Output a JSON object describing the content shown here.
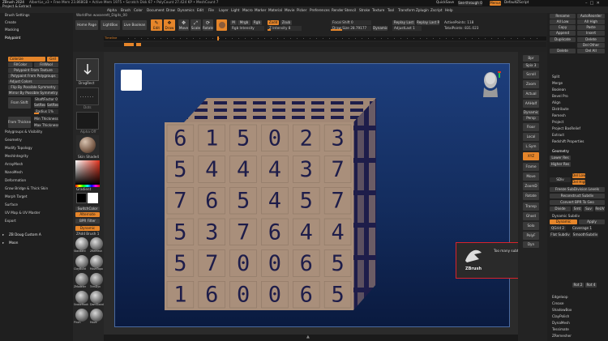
{
  "titlebar": {
    "app": "ZBrush 2024",
    "items": [
      "AlbertLe_v3",
      "Free Mem 23.868GB",
      "Active Mem 1975",
      "Scratch Disk 67",
      "PolyCount 27.424 KP",
      "MeshCount 7"
    ],
    "quicksave": "QuickSave",
    "seethrough": "See-through 0",
    "menus_btn": "Menus",
    "script": "DefaultZScript"
  },
  "menubar": [
    "Alpha",
    "Brush",
    "Color",
    "Document",
    "Draw",
    "Dynamics",
    "Edit",
    "File",
    "Layer",
    "Light",
    "Macro",
    "Marker",
    "Material",
    "Movie",
    "Picker",
    "Preferences",
    "Render",
    "Stencil",
    "Stroke",
    "Texture",
    "Tool",
    "Transform",
    "Zplugin",
    "Zscript",
    "Help"
  ],
  "context_line": "WorldPan wasserett_Digits_00",
  "toolbar": {
    "home": "Home Page",
    "lightbox": "LightBox",
    "livebool": "Live Boolean",
    "edit": "Edit",
    "draw": "Draw",
    "move": "Move",
    "scale": "Scale",
    "rotate": "Rotate",
    "mrgb": "Mrgb",
    "rgb": "Rgb",
    "m": "M",
    "zadd": "Zadd",
    "zsub": "Zsub",
    "rgb_intensity": "Rgb Intensity",
    "z_intensity": "Z Intensity 8",
    "focal_shift": "Focal Shift 0",
    "draw_size": "Draw Size 28.79177",
    "dynamic": "Dynamic",
    "active_points": "ActivePoints: 118",
    "total_points": "TotalPoints: 831.023",
    "adjust_last": "AdjustLast 1",
    "replay": "Replay Last",
    "replay_rel": "Replay Last Rel",
    "timeline": "Timeline"
  },
  "left_panel": {
    "header": "Project & Extract",
    "items": [
      "Brush Settings",
      "Create",
      "Masking",
      "Polypaint"
    ],
    "colorize": "Colorize",
    "grd": "Grd",
    "fill_color": "FillColor",
    "fill_wool": "FillWool",
    "polypaint_from_texture": "Polypaint From Texture",
    "polypaint_from_polygroups": "Polypaint From Polygroups",
    "adjust_colors": "Adjust Colors",
    "flip_poly_sym": "Flip By Possible Symmetry",
    "mirror_poly_sym": "Mirror By Possible Symmetry",
    "from_shift": "From Shift",
    "from_thickness": "From Thickness",
    "shaft_factor": "ShaftFactor 0",
    "set_a": "SetRes",
    "set_b": "SetRes",
    "radius": "Radius 1%",
    "min": "Min Thickness",
    "max": "Max Thickness",
    "sections": [
      "Polygroups & Visibility",
      "Geometry",
      "Modify Topology",
      "MeshIntegrity",
      "ArrayMesh",
      "NanoMesh",
      "Deformation",
      "Grow Bridge & Thick Skin",
      "Morph Target",
      "Surface",
      "UV Map & UV Master",
      "Export"
    ],
    "subtool": "ZB Doug Custom A",
    "moon": "Moon"
  },
  "shelf": {
    "dragrect": "DragRect",
    "dots": "Dots",
    "alpha": "Alpha Off",
    "matcap": "Skin Shade4",
    "gradient": "Gradient",
    "switch": "SwitchColor",
    "alternate": "Alternate",
    "bpr": "BPR Filter",
    "dynamic_mode": "Dynamic",
    "zadd_b": "ZAdd Brush 1",
    "brushes": [
      "Standard",
      "ZRemesh",
      "ClayBuild",
      "MoveTopo",
      "ZModeler",
      "TrimDyn",
      "SnakeHook",
      "DamStandar",
      "Pinch",
      "Move",
      "hPolish",
      "Inflate",
      "DoubleMat"
    ]
  },
  "right_column": [
    "Bpr",
    "Spix 3",
    "Scroll",
    "Zoom",
    "Actual",
    "AAHalf",
    "Dynamic",
    "Persp",
    "Floor",
    "Local",
    "L.Sym",
    "XYZ",
    "Frame",
    "Move",
    "ZoomD",
    "Rotate",
    "Transp",
    "Ghost",
    "Solo",
    "PolyF",
    "Dyn"
  ],
  "right_panel": {
    "top_rows": [
      [
        "Rename",
        "AutoReorder"
      ],
      [
        "All Low",
        "All High"
      ],
      [
        "Copy",
        "Paste"
      ],
      [
        "Append",
        "Insert"
      ],
      [
        "Duplicate",
        "Delete"
      ],
      [
        "",
        "Del Other"
      ],
      [
        "Delete",
        "Del All"
      ],
      [
        "Split",
        "Merge"
      ]
    ],
    "list_a": [
      "Split",
      "Merge",
      "Boolean",
      "Bevel Pro",
      "Align",
      "Distribute",
      "Remesh",
      "Project",
      "Project BasRelief",
      "Extract",
      "Redshift Properties"
    ],
    "geometry": "Geometry",
    "lower_res": "Lower Res",
    "higher_res": "Higher Res",
    "sdiv": "SDiv",
    "del_lower": "Del Lower",
    "del_higher": "Del Higher",
    "freeze": "Freeze SubDivision Levels",
    "reconstruct": "Reconstruct Subdiv",
    "convert_bpr": "Convert BPR To Geo",
    "divide": "Divide",
    "smt": "Smt",
    "suv": "Suv",
    "reuv": "ReUV",
    "dynamic_subdiv": "Dynamic Subdiv",
    "dynamic": "Dynamic",
    "apply": "Apply",
    "qgrid": "QGrid 2",
    "coverage": "Coverage 1",
    "flat_subdiv": "Flat Subdiv",
    "smooth_subdiv": "SmoothSubdiv",
    "list_b": [
      "Edgeloop",
      "Crease",
      "ShadowBox",
      "ClayPolish",
      "DynaMesh",
      "Tessimate",
      "ZRemesher"
    ],
    "rot_labels": [
      "Rot 2",
      "Rot 4"
    ]
  },
  "tooltip": {
    "logo_text": "ZBrush",
    "message": "Too many subtools are included and they will be skipped"
  },
  "cube": {
    "rows": [
      "615023",
      "544437",
      "765457",
      "537644",
      "570065",
      "160065"
    ],
    "side_color": "#a98f7b",
    "top_color": "#a18775",
    "dark_color": "#1e1d4a"
  },
  "colors": {
    "accent": "#e5852a",
    "tooltip_border": "#d9232b",
    "viewport_top": "#1d3e7c",
    "viewport_bottom": "#0a1a3f"
  }
}
